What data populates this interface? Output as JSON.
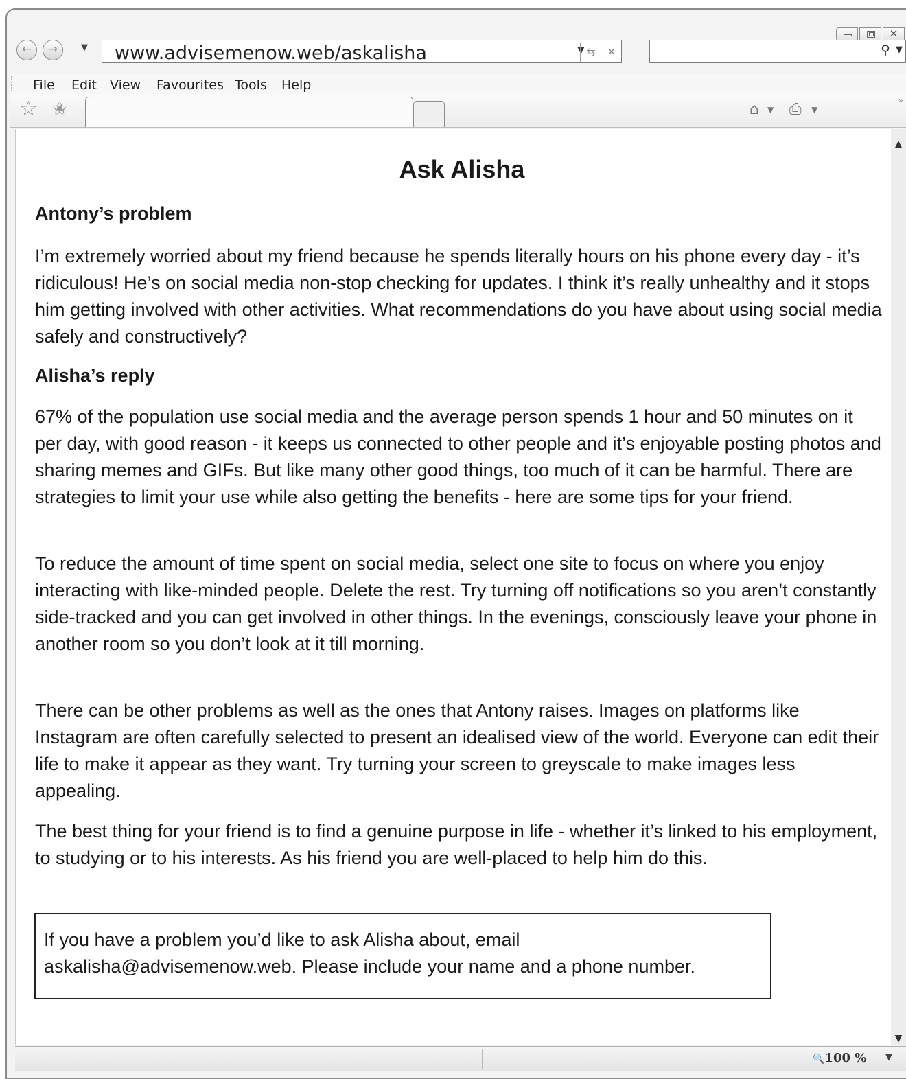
{
  "browser": {
    "url": "www.advisemenow.web/askalisha",
    "menu": [
      "File",
      "Edit",
      "View",
      "Favourites",
      "Tools",
      "Help"
    ],
    "zoom": "100 %"
  },
  "article": {
    "title": "Ask Alisha",
    "problem_heading": "Antony’s problem",
    "problem_text": "I’m extremely worried about my friend because he spends literally hours on his phone every day - it’s ridiculous! He’s on social media non-stop checking for updates.  I think it’s really unhealthy and it stops him getting involved with other activities. What recommendations do you have about using social media safely and constructively?",
    "reply_heading": "Alisha’s reply",
    "reply_paragraphs": [
      "67% of the population use social media and the average person spends 1 hour and 50 minutes on it per day, with good reason - it keeps us connected to other people and it’s enjoyable posting photos and sharing memes and GIFs. But like many other good things, too much of it can be harmful. There are strategies to limit your use while also getting the benefits - here are some tips for your friend.",
      "To reduce the amount of time spent on social media, select one site to focus on where you enjoy interacting with like-minded people. Delete the rest. Try turning off notifications so you aren’t constantly side-tracked and you can get involved in other things. In the evenings, consciously leave your phone in another room so you don’t look at it till morning.",
      "There can be other problems as well as the ones that Antony raises. Images on platforms like Instagram are often carefully selected to present an idealised view of the world. Everyone can edit their life to make it appear as they want. Try turning your screen to greyscale to make images less appealing.",
      "The best thing for your friend is to find a genuine purpose in life - whether it’s linked to his employment, to studying or to his interests. As his friend you are well-placed to help him do this."
    ],
    "contact_note": "If you have a problem you’d like to ask Alisha about, email askalisha@advisemenow.web. Please include your name and a phone number."
  }
}
